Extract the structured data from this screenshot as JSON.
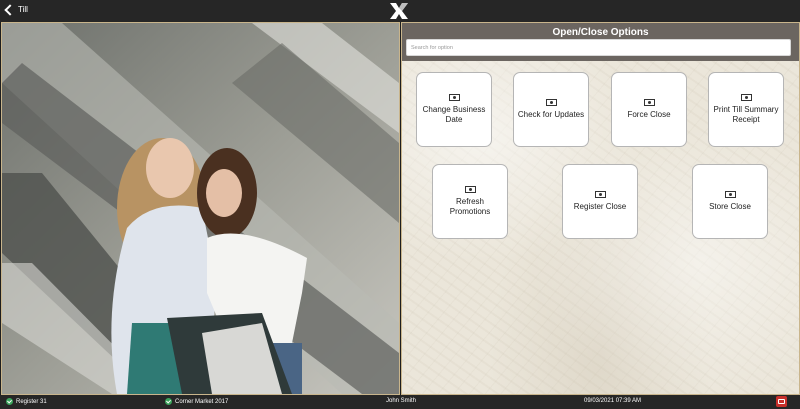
{
  "topbar": {
    "back_label": "Till",
    "logo_icon": "x-logo-icon"
  },
  "panel": {
    "title": "Open/Close Options",
    "search_placeholder": "Search for option",
    "options": [
      {
        "label": "Change Business Date",
        "icon": "till-icon"
      },
      {
        "label": "Check for Updates",
        "icon": "till-icon"
      },
      {
        "label": "Force Close",
        "icon": "till-icon"
      },
      {
        "label": "Print Till Summary Receipt",
        "icon": "till-icon"
      },
      {
        "label": "Refresh Promotions",
        "icon": "till-icon"
      },
      {
        "label": "Register Close",
        "icon": "till-icon"
      },
      {
        "label": "Store Close",
        "icon": "till-icon"
      }
    ]
  },
  "statusbar": {
    "register": "Register 31",
    "store": "Corner Market 2017",
    "user": "John Smith",
    "datetime": "09/03/2021 07:39 AM"
  },
  "colors": {
    "status_ok": "#3aa35b",
    "alert": "#c9302c",
    "panel_header": "#6b6560"
  }
}
